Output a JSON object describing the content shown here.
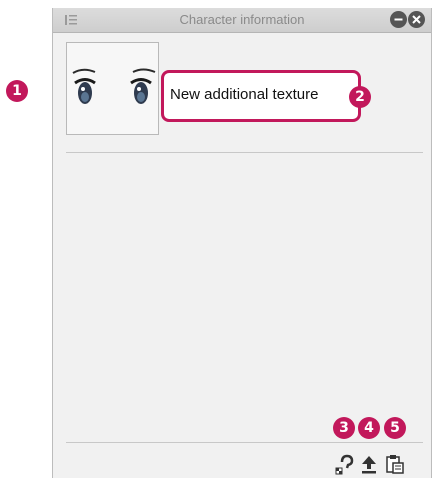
{
  "panel": {
    "title": "Character information"
  },
  "character": {
    "texture_name": "New additional texture"
  },
  "annotations": {
    "n1": "1",
    "n2": "2",
    "n3": "3",
    "n4": "4",
    "n5": "5"
  },
  "icons": {
    "menu": "panel-menu-icon",
    "minimize": "minimize-icon",
    "close": "close-icon",
    "texture_set": "texture-set-icon",
    "upload": "upload-icon",
    "paste": "paste-icon"
  },
  "colors": {
    "annotation": "#c2185b",
    "panel_bg": "#f1f1f1",
    "titlebar": "#d4d4d4"
  }
}
